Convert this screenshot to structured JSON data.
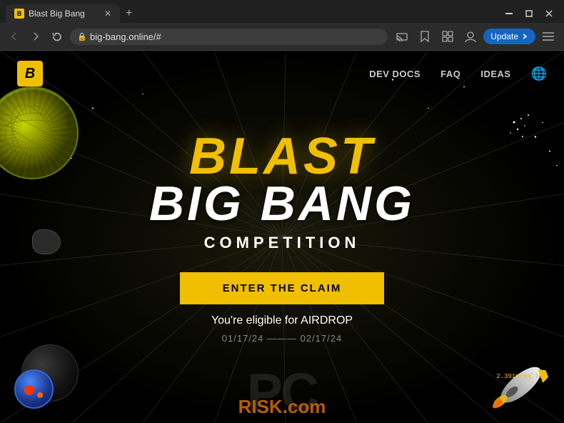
{
  "browser": {
    "tab_title": "Blast Big Bang",
    "tab_favicon": "B",
    "url": "big-bang.online/#",
    "new_tab_label": "+",
    "window_controls": {
      "minimize": "—",
      "maximize": "□",
      "close": "✕"
    },
    "update_button": "Update",
    "nav": {
      "back": "←",
      "forward": "→",
      "reload": "↺"
    }
  },
  "site": {
    "logo": "B",
    "nav_links": [
      "DEV DOCS",
      "FAQ",
      "IDEAS"
    ],
    "main_title_line1": "BLAST",
    "main_title_line2": "BIG BANG",
    "subtitle": "COMPETITION",
    "claim_button": "ENTER THE CLAIM",
    "airdrop_text": "You're eligible for AIRDROP",
    "date_range": "01/17/24 ——— 02/17/24",
    "speed_indicator": "2.391m/eq.lu"
  },
  "watermark": {
    "logo_text": "PC",
    "risk_text": "RISK.com"
  }
}
